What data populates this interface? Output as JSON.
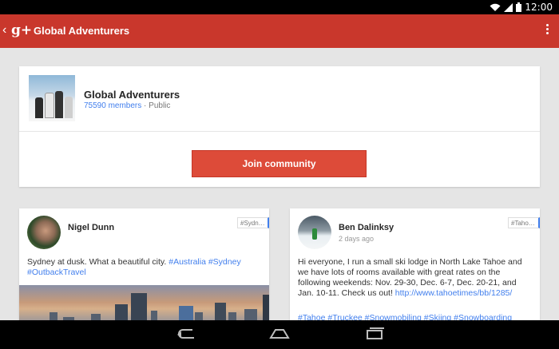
{
  "status_bar": {
    "time": "12:00"
  },
  "action_bar": {
    "title": "Global Adventurers",
    "logo_text": "g+"
  },
  "community": {
    "name": "Global Adventurers",
    "members": "75590 members",
    "separator": " · ",
    "visibility": "Public",
    "join_label": "Join community"
  },
  "posts": [
    {
      "author": "Nigel Dunn",
      "time": "",
      "tag": "#Sydn…",
      "text_plain": "Sydney at dusk. What a beautiful city. ",
      "hashtags_inline": "#Australia #Sydney #OutbackTravel",
      "hashtags_line": ""
    },
    {
      "author": "Ben Dalinksy",
      "time": "2 days ago",
      "tag": "#Taho…",
      "text_plain": "Hi everyone, I run a small ski lodge in North Lake Tahoe and we have lots of rooms available with great rates on the following weekends: Nov. 29-30, Dec. 6-7, Dec. 20-21, and Jan. 10-11. Check us out! ",
      "link": "http://www.tahoetimes/bb/1285/",
      "hashtags_line": "#Tahoe #Truckee #Snowmobiling #Skiing #Snowboarding"
    }
  ],
  "colors": {
    "brand": "#c9372c",
    "button": "#dd4b39",
    "link": "#427fed",
    "background": "#e5e5e5"
  },
  "icons": [
    "wifi-icon",
    "signal-icon",
    "battery-icon",
    "back-icon",
    "overflow-menu-icon",
    "nav-back-icon",
    "nav-home-icon",
    "nav-recents-icon"
  ]
}
